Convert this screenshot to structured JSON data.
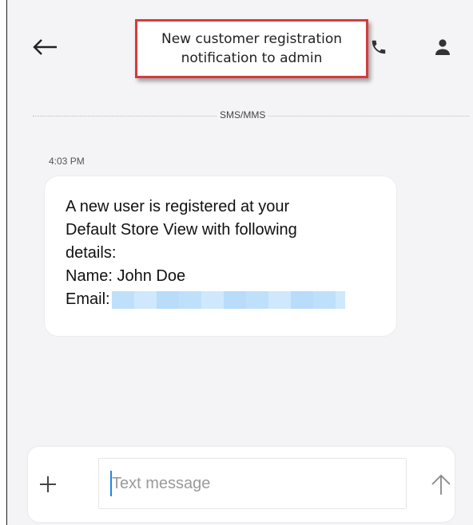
{
  "callout": {
    "line1": "New customer registration",
    "line2": "notification to admin"
  },
  "header": {
    "back_icon": "back-arrow-icon",
    "call_icon": "phone-icon",
    "contact_icon": "person-icon"
  },
  "thread": {
    "divider_label": "SMS/MMS",
    "timestamp": "4:03 PM",
    "message": {
      "line1": "A new user is registered at your",
      "line2": "Default Store View with following",
      "line3": "details:",
      "line4": "Name: John Doe",
      "email_label": "Email:"
    }
  },
  "compose": {
    "placeholder": "Text message",
    "add_icon": "plus-icon",
    "send_icon": "send-arrow-up-icon"
  },
  "colors": {
    "callout_border": "#d63b3b",
    "caret": "#1e88e5",
    "redaction": "#bfe0fb"
  }
}
